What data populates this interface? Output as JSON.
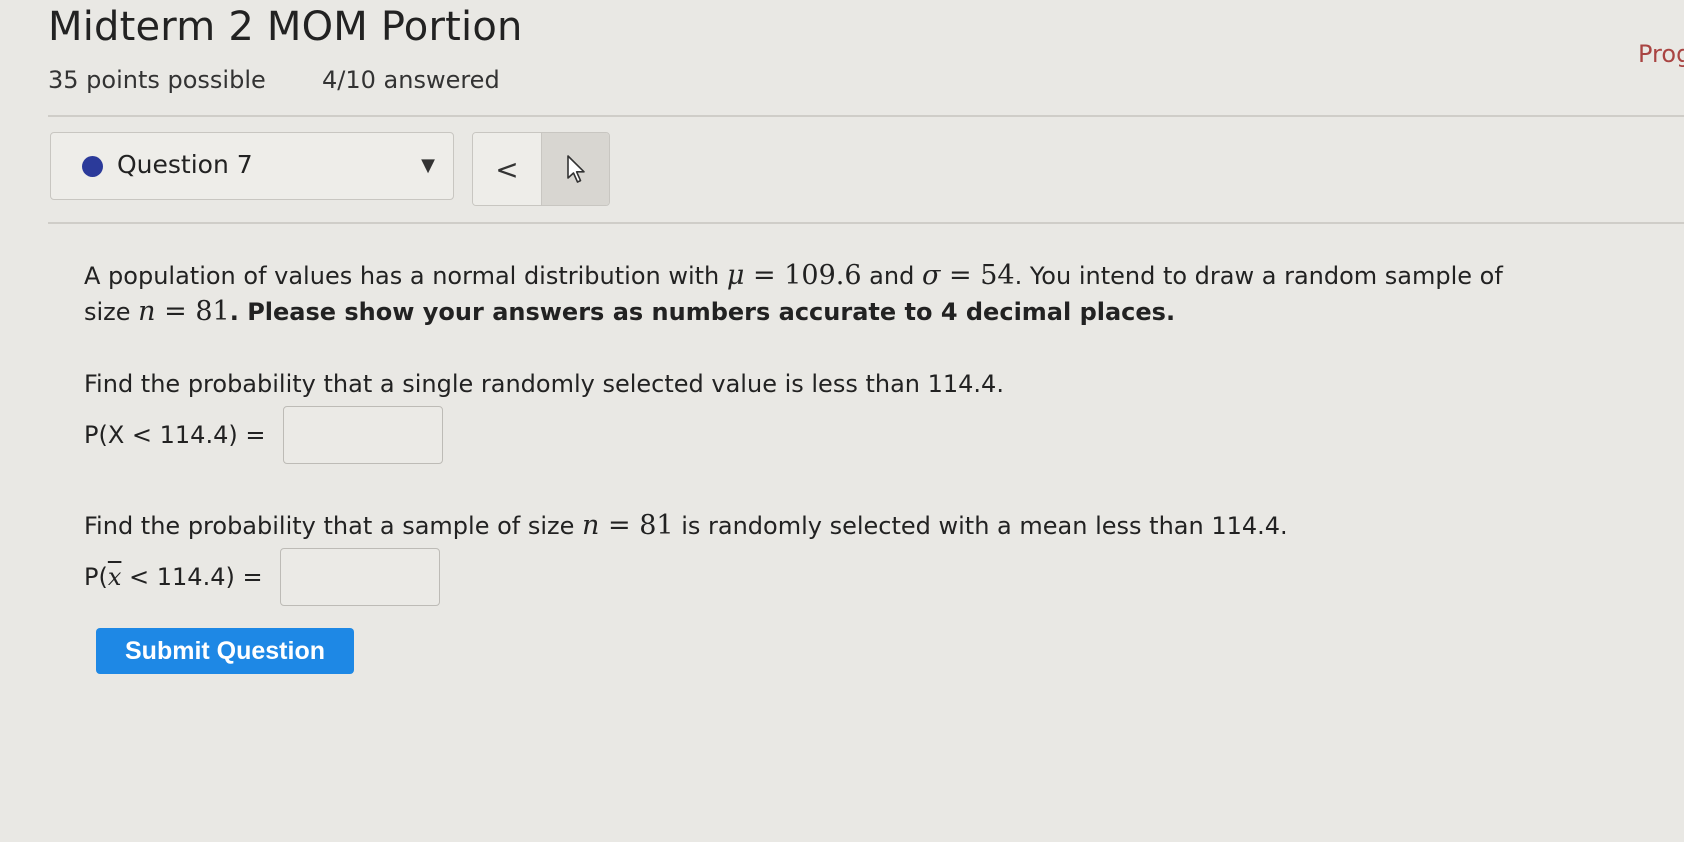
{
  "header": {
    "title": "Midterm 2 MOM Portion",
    "points": "35 points possible",
    "answered": "4/10 answered",
    "right_link": "Progress"
  },
  "question_select": {
    "label": "Question 7",
    "caret": "▼",
    "dot_color": "#2b3a9a"
  },
  "nav": {
    "prev": "<",
    "next_icon": "cursor-arrow-icon"
  },
  "question": {
    "intro_1": "A population of values has a normal distribution with ",
    "mu": "μ",
    "eq": " = ",
    "mu_val": "109.6",
    "and": " and ",
    "sigma": "σ",
    "sigma_val": "54",
    "intro_2": ". You intend to draw a random sample of size ",
    "n": "n",
    "n_val": "81",
    "intro_3": ". Please show your answers as numbers accurate to 4 decimal places.",
    "part1_prompt": "Find the probability that a single randomly selected value is less than 114.4.",
    "part1_label": "P(X < 114.4) = ",
    "part2_prompt_a": "Find the probability that a sample of size ",
    "part2_prompt_b": " is randomly selected with a mean less than 114.4.",
    "part2_label_a": "P(",
    "part2_xbar": "x",
    "part2_label_b": " < 114.4) = ",
    "part1_value": "",
    "part2_value": ""
  },
  "submit": {
    "label": "Submit Question",
    "color": "#1e88e5"
  }
}
